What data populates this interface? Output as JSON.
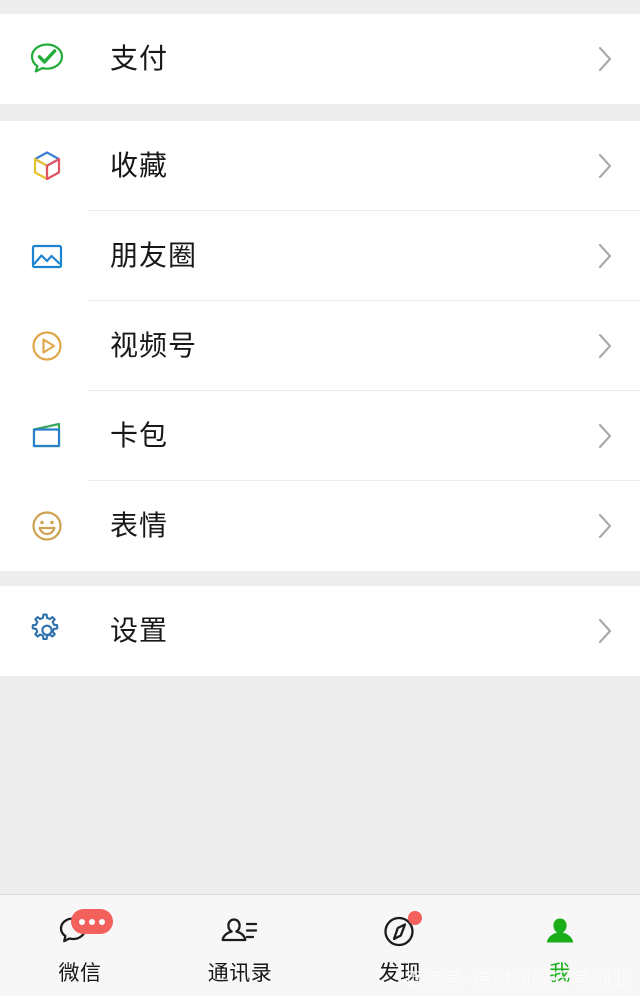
{
  "screen": {
    "name": "wechat-me-page",
    "background_color": "#ededed",
    "card_color": "#ffffff"
  },
  "sections": [
    {
      "id": "pay-section",
      "items": [
        {
          "id": "pay",
          "label": "支付",
          "icon": "pay-bubble-icon",
          "icon_color": "#22ac38",
          "chevron": "chevron-right-icon"
        }
      ]
    },
    {
      "id": "services-section",
      "items": [
        {
          "id": "favorites",
          "label": "收藏",
          "icon": "favorites-cube-icon",
          "icon_color": "#3b7fd4",
          "chevron": "chevron-right-icon"
        },
        {
          "id": "moments",
          "label": "朋友圈",
          "icon": "moments-photo-icon",
          "icon_color": "#1d84d1",
          "chevron": "chevron-right-icon"
        },
        {
          "id": "channels",
          "label": "视频号",
          "icon": "channels-play-icon",
          "icon_color": "#e0a64a",
          "chevron": "chevron-right-icon"
        },
        {
          "id": "cards",
          "label": "卡包",
          "icon": "cards-wallet-icon",
          "icon_color": "#2a7fc9",
          "chevron": "chevron-right-icon"
        },
        {
          "id": "stickers",
          "label": "表情",
          "icon": "stickers-smiley-icon",
          "icon_color": "#cfa152",
          "chevron": "chevron-right-icon"
        }
      ]
    },
    {
      "id": "settings-section",
      "items": [
        {
          "id": "settings",
          "label": "设置",
          "icon": "settings-gear-icon",
          "icon_color": "#3071ad",
          "chevron": "chevron-right-icon"
        }
      ]
    }
  ],
  "tabbar": {
    "background_color": "#f7f7f7",
    "active_color": "#1aad19",
    "badge_color": "#f4615c",
    "tabs": [
      {
        "id": "chats",
        "label": "微信",
        "icon": "chat-bubble-icon",
        "badge": "dots",
        "active": false
      },
      {
        "id": "contacts",
        "label": "通讯录",
        "icon": "contacts-person-icon",
        "badge": "none",
        "active": false
      },
      {
        "id": "discover",
        "label": "发现",
        "icon": "discover-compass-icon",
        "badge": "dot",
        "active": false
      },
      {
        "id": "me",
        "label": "我",
        "icon": "me-person-icon",
        "badge": "none",
        "active": true
      }
    ]
  },
  "watermark": {
    "text": "百家号·传时网政行号创业"
  }
}
